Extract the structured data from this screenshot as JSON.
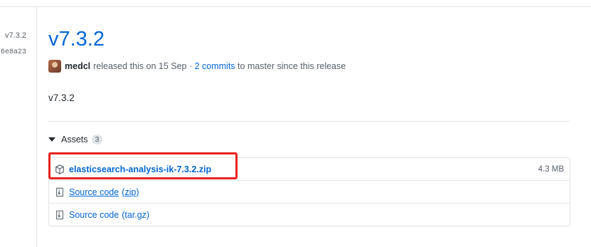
{
  "sidebar": {
    "tag": "v7.3.2",
    "sha": "6e8a23"
  },
  "release": {
    "title": "v7.3.2",
    "author": "medcl",
    "released_text": "released this on 15 Sep ·",
    "commits_link": "2 commits",
    "commits_suffix": "to master since this release",
    "body": "v7.3.2"
  },
  "assets": {
    "label": "Assets",
    "count": "3",
    "items": [
      {
        "name": "elasticsearch-analysis-ik-7.3.2.zip",
        "size": "4.3 MB",
        "icon": "package-icon"
      },
      {
        "name": "Source code",
        "format": "(zip)",
        "icon": "file-zip-icon"
      },
      {
        "name": "Source code",
        "format": "(tar.gz)",
        "icon": "file-zip-icon"
      }
    ]
  },
  "colors": {
    "link": "#0366d6",
    "highlight": "#e8231f",
    "border": "#e1e4e8"
  }
}
